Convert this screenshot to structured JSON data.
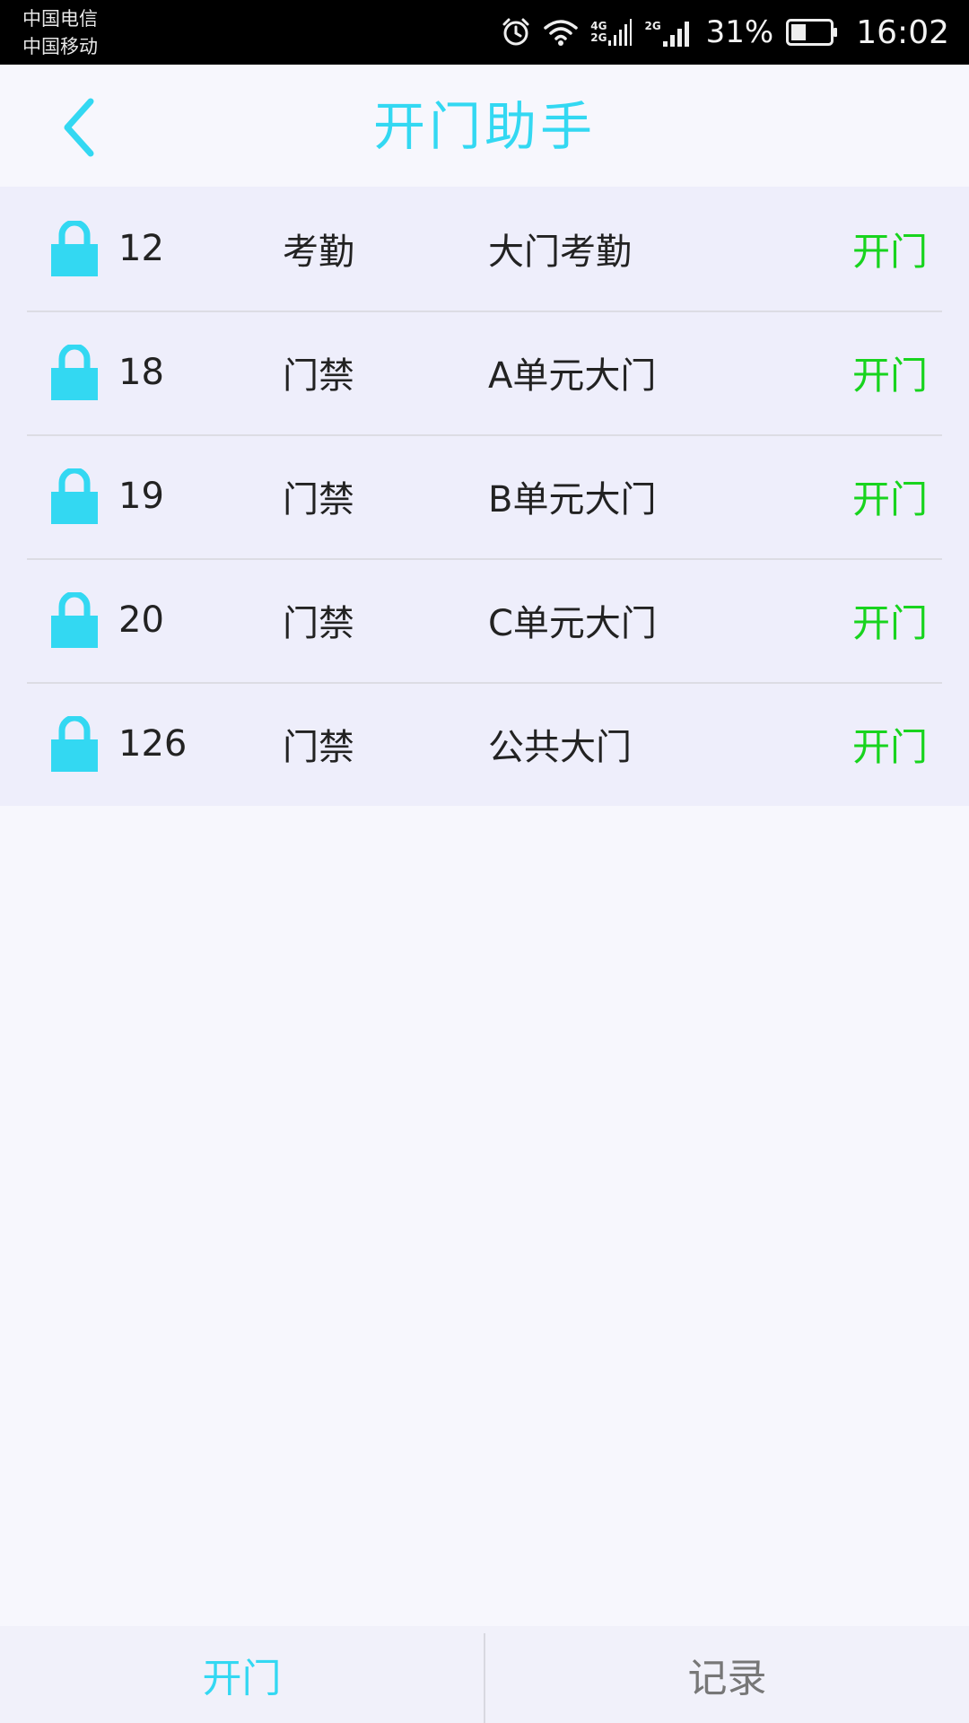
{
  "status_bar": {
    "carrier_1": "中国电信",
    "carrier_2": "中国移动",
    "network_1": "4G",
    "network_2": "2G",
    "network_3": "2G",
    "battery_percent": "31%",
    "time": "16:02",
    "icons": [
      "alarm-icon",
      "wifi-icon",
      "signal-icon",
      "signal-icon",
      "battery-icon"
    ]
  },
  "header": {
    "title": "开门助手",
    "back_icon": "chevron-left-icon"
  },
  "doors": [
    {
      "id": "12",
      "type": "考勤",
      "name": "大门考勤",
      "action": "开门"
    },
    {
      "id": "18",
      "type": "门禁",
      "name": "A单元大门",
      "action": "开门"
    },
    {
      "id": "19",
      "type": "门禁",
      "name": "B单元大门",
      "action": "开门"
    },
    {
      "id": "20",
      "type": "门禁",
      "name": "C单元大门",
      "action": "开门"
    },
    {
      "id": "126",
      "type": "门禁",
      "name": "公共大门",
      "action": "开门"
    }
  ],
  "tabs": {
    "open": "开门",
    "records": "记录"
  },
  "colors": {
    "accent": "#33d8f2",
    "open_action": "#18d41e",
    "lock_icon": "#33d8f2"
  }
}
